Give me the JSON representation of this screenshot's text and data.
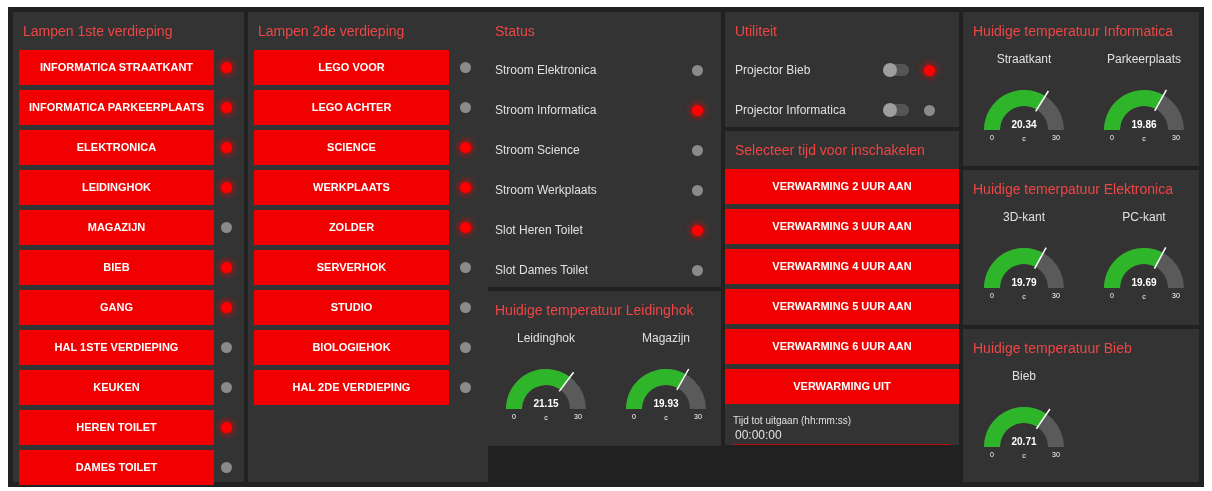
{
  "floor1": {
    "title": "Lampen 1ste verdieping",
    "items": [
      {
        "label": "INFORMATICA STRAATKANT",
        "on": true
      },
      {
        "label": "INFORMATICA PARKEERPLAATS",
        "on": true
      },
      {
        "label": "ELEKTRONICA",
        "on": true
      },
      {
        "label": "LEIDINGHOK",
        "on": true
      },
      {
        "label": "MAGAZIJN",
        "on": false
      },
      {
        "label": "BIEB",
        "on": true
      },
      {
        "label": "GANG",
        "on": true
      },
      {
        "label": "HAL 1STE VERDIEPING",
        "on": false
      },
      {
        "label": "KEUKEN",
        "on": false
      },
      {
        "label": "HEREN TOILET",
        "on": true
      },
      {
        "label": "DAMES TOILET",
        "on": false
      }
    ]
  },
  "floor2": {
    "title": "Lampen 2de verdieping",
    "items": [
      {
        "label": "LEGO VOOR",
        "on": false
      },
      {
        "label": "LEGO ACHTER",
        "on": false
      },
      {
        "label": "SCIENCE",
        "on": true
      },
      {
        "label": "WERKPLAATS",
        "on": true
      },
      {
        "label": "ZOLDER",
        "on": true
      },
      {
        "label": "SERVERHOK",
        "on": false
      },
      {
        "label": "STUDIO",
        "on": false
      },
      {
        "label": "BIOLOGIEHOK",
        "on": false
      },
      {
        "label": "HAL 2DE VERDIEPING",
        "on": false
      }
    ]
  },
  "status": {
    "title": "Status",
    "items": [
      {
        "label": "Stroom Elektronica",
        "on": false
      },
      {
        "label": "Stroom Informatica",
        "on": true
      },
      {
        "label": "Stroom Science",
        "on": false
      },
      {
        "label": "Stroom Werkplaats",
        "on": false
      },
      {
        "label": "Slot Heren Toilet",
        "on": true
      },
      {
        "label": "Slot Dames Toilet",
        "on": false
      }
    ]
  },
  "temp_leidinghok": {
    "title": "Huidige temperatuur Leidinghok",
    "gauges": [
      {
        "label": "Leidinghok",
        "value": "21.15",
        "min": "0",
        "max": "30",
        "unit": "c"
      },
      {
        "label": "Magazijn",
        "value": "19.93",
        "min": "0",
        "max": "30",
        "unit": "c"
      }
    ]
  },
  "utility": {
    "title": "Utiliteit",
    "items": [
      {
        "label": "Projector Bieb",
        "on": false,
        "lamp_on": true
      },
      {
        "label": "Projector Informatica",
        "on": false,
        "lamp_on": false
      }
    ]
  },
  "timer": {
    "title": "Selecteer tijd voor inschakelen",
    "buttons": [
      "VERWARMING 2 UUR AAN",
      "VERWARMING 3 UUR AAN",
      "VERWARMING 4 UUR AAN",
      "VERWARMING 5 UUR AAN",
      "VERWARMING 6 UUR AAN",
      "VERWARMING UIT"
    ],
    "field": {
      "label": "Tijd tot uitgaan (hh:mm:ss)",
      "value": "00:00:00"
    }
  },
  "temp_informatica": {
    "title": "Huidige temperatuur Informatica",
    "gauges": [
      {
        "label": "Straatkant",
        "value": "20.34",
        "min": "0",
        "max": "30",
        "unit": "c"
      },
      {
        "label": "Parkeerplaats",
        "value": "19.86",
        "min": "0",
        "max": "30",
        "unit": "c"
      }
    ]
  },
  "temp_elektronica": {
    "title": "Huidige temerpatuur Elektronica",
    "gauges": [
      {
        "label": "3D-kant",
        "value": "19.79",
        "min": "0",
        "max": "30",
        "unit": "c"
      },
      {
        "label": "PC-kant",
        "value": "19.69",
        "min": "0",
        "max": "30",
        "unit": "c"
      }
    ]
  },
  "temp_bieb": {
    "title": "Huidige temperatuur Bieb",
    "gauges": [
      {
        "label": "Bieb",
        "value": "20.71",
        "min": "0",
        "max": "30",
        "unit": "c"
      }
    ]
  }
}
